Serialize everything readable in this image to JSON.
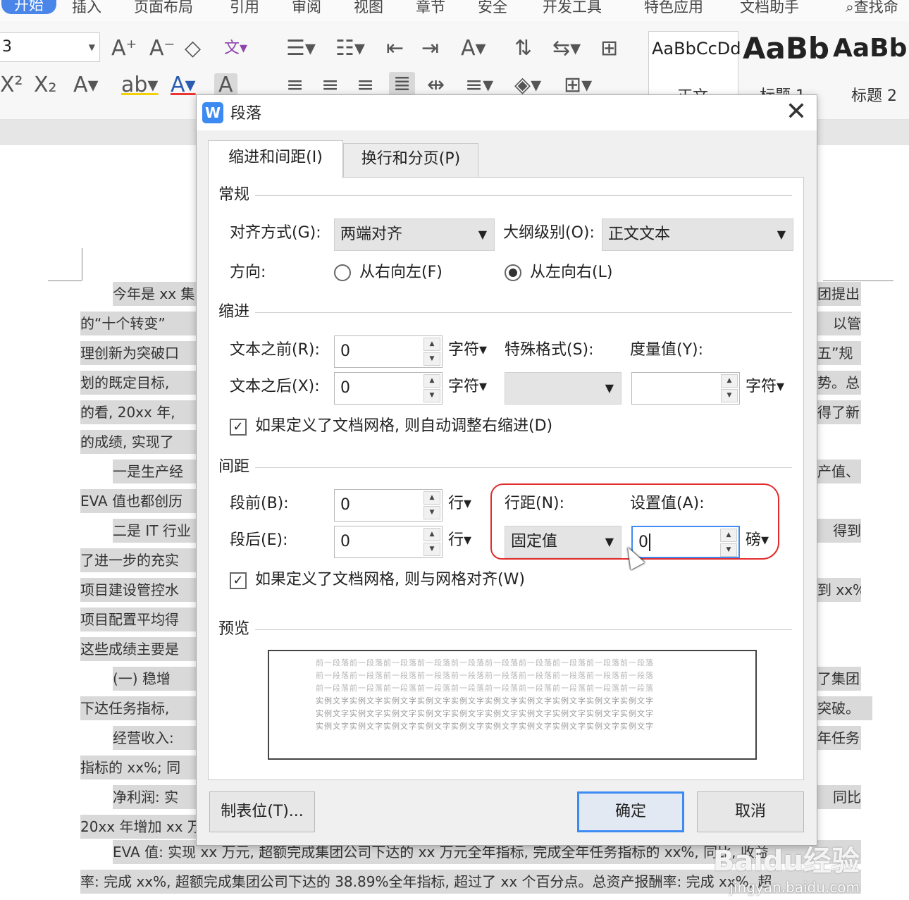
{
  "menubar": {
    "items": [
      "开始",
      "插入",
      "页面布局",
      "引用",
      "审阅",
      "视图",
      "章节",
      "安全",
      "开发工具",
      "特色应用",
      "文档助手",
      "查找命"
    ]
  },
  "toolbar": {
    "font_size_value": "3",
    "style_gallery": [
      {
        "preview": "AaBbCcDd",
        "label": "正文"
      },
      {
        "preview": "AaBb",
        "label": "标题 1"
      },
      {
        "preview": "AaBb",
        "label": "标题 2"
      }
    ]
  },
  "document": {
    "left_lines": [
      "今年是 xx 集",
      "的“十个转变”",
      "理创新为突破口",
      "划的既定目标,",
      "的看, 20xx 年,",
      "的成绩, 实现了",
      "一是生产经",
      "EVA 值也都创历",
      "二是 IT 行业",
      "了进一步的充实",
      "项目建设管控水",
      "项目配置平均得",
      "这些成绩主要是",
      "(一) 稳增",
      "下达任务指标,",
      "经营收入:",
      "指标的 xx%; 同",
      "净利润: 实",
      "20xx 年增加 xx 万"
    ],
    "right_lines": [
      "团提出",
      "以管",
      "五”规",
      "势。总",
      "得了新",
      "产值、",
      "得到",
      "到 xx%,",
      "了集团",
      "突破。",
      "年任务",
      "同比"
    ],
    "bottom_lines": [
      "EVA 值: 实现 xx 万元, 超额完成集团公司下达的 xx 万元全年指标, 完成全年任务指标的 xx%, 同比, 收益",
      "率: 完成 xx%, 超额完成集团公司下达的 38.89%全年指标, 超过了 xx 个百分点。总资产报酬率: 完成 xx%, 超"
    ]
  },
  "dialog": {
    "title": "段落",
    "app_icon_letter": "W",
    "tabs": [
      "缩进和间距(I)",
      "换行和分页(P)"
    ],
    "general": {
      "section": "常规",
      "align_label": "对齐方式(G):",
      "align_value": "两端对齐",
      "outline_label": "大纲级别(O):",
      "outline_value": "正文文本",
      "direction_label": "方向:",
      "rtl_label": "从右向左(F)",
      "ltr_label": "从左向右(L)"
    },
    "indent": {
      "section": "缩进",
      "before_label": "文本之前(R):",
      "before_value": "0",
      "after_label": "文本之后(X):",
      "after_value": "0",
      "unit": "字符▾",
      "special_label": "特殊格式(S):",
      "special_value": "",
      "measure_label": "度量值(Y):",
      "measure_value": "",
      "measure_unit": "字符▾",
      "grid_check": "如果定义了文档网格, 则自动调整右缩进(D)"
    },
    "spacing": {
      "section": "间距",
      "before_label": "段前(B):",
      "before_value": "0",
      "after_label": "段后(E):",
      "after_value": "0",
      "unit": "行▾",
      "line_label": "行距(N):",
      "line_value": "固定值",
      "set_label": "设置值(A):",
      "set_value": "0",
      "set_unit": "磅▾",
      "grid_check": "如果定义了文档网格, 则与网格对齐(W)"
    },
    "preview": {
      "section": "预览",
      "line_prev": "前一段落前一段落前一段落前一段落前一段落前一段落前一段落前一段落前一段落前一段落",
      "line_sample": "实例文字实例文字实例文字实例文字实例文字实例文字实例文字实例文字实例文字实例文字"
    },
    "buttons": {
      "tabs_btn": "制表位(T)...",
      "ok": "确定",
      "cancel": "取消"
    }
  },
  "watermark": {
    "brand": "Baidu经验",
    "url": "jingyan.baidu.com"
  },
  "colors": {
    "accent": "#3d8bf2",
    "highlight": "#e32b2b",
    "text_shade": "#d9d9d9"
  }
}
